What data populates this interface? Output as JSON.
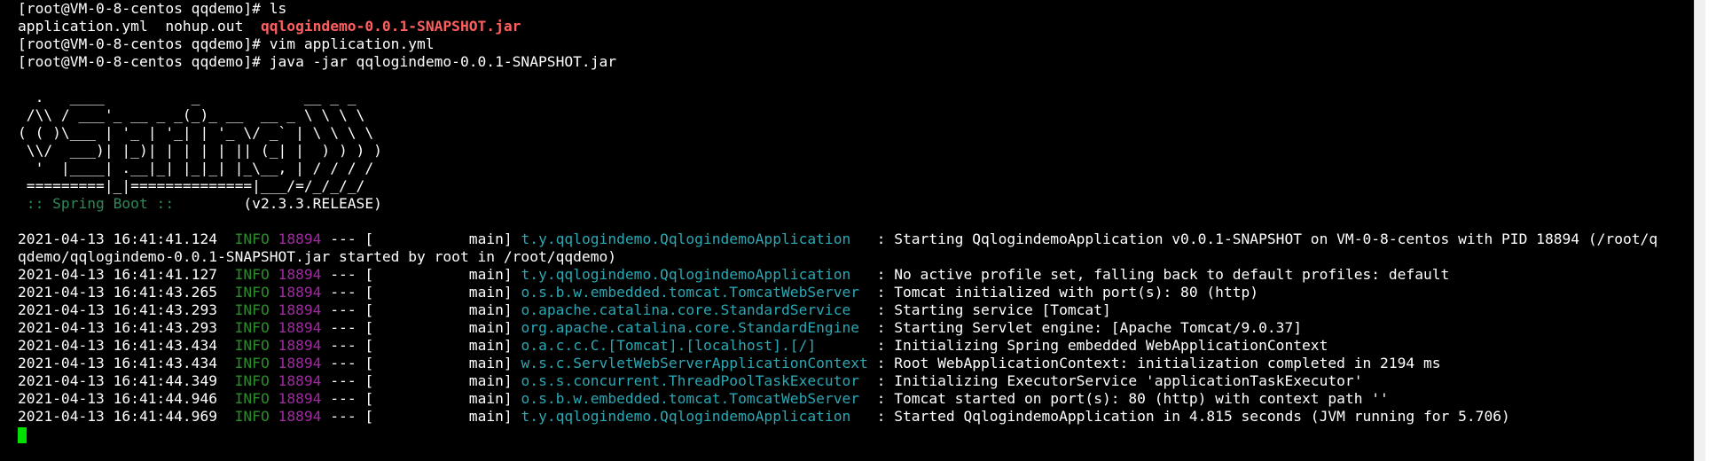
{
  "colors": {
    "background": "#000000",
    "text": "#ffffff",
    "jar_file": "#ff5f5f",
    "spring_label": "#2e8b57",
    "info_level": "#2a8c2a",
    "pid": "#a02aa0",
    "logger": "#2aa8b4",
    "cursor": "#00e000"
  },
  "shell": {
    "line1": "[root@VM-0-8-centos qqdemo]# ls",
    "ls_files_plain": "application.yml  nohup.out  ",
    "ls_jar": "qqlogindemo-0.0.1-SNAPSHOT.jar",
    "line3": "[root@VM-0-8-centos qqdemo]# vim application.yml",
    "line4": "[root@VM-0-8-centos qqdemo]# java -jar qqlogindemo-0.0.1-SNAPSHOT.jar"
  },
  "banner": {
    "art": [
      "  .   ____          _            __ _ _",
      " /\\\\ / ___'_ __ _ _(_)_ __  __ _ \\ \\ \\ \\",
      "( ( )\\___ | '_ | '_| | '_ \\/ _` | \\ \\ \\ \\",
      " \\\\/  ___)| |_)| | | | | || (_| |  ) ) ) )",
      "  '  |____| .__|_| |_|_| |_\\__, | / / / /",
      " =========|_|==============|___/=/_/_/_/"
    ],
    "spring_label": " :: Spring Boot :: ",
    "version": "       (v2.3.3.RELEASE)"
  },
  "logs": [
    {
      "ts": "2021-04-13 16:41:41.124",
      "level": "INFO",
      "pid": "18894",
      "thread": " --- [           main] ",
      "logger": "t.y.qqlogindemo.QqlogindemoApplication  ",
      "msg": " : Starting QqlogindemoApplication v0.0.1-SNAPSHOT on VM-0-8-centos with PID 18894 (/root/q"
    },
    {
      "continuation": "qdemo/qqlogindemo-0.0.1-SNAPSHOT.jar started by root in /root/qqdemo)"
    },
    {
      "ts": "2021-04-13 16:41:41.127",
      "level": "INFO",
      "pid": "18894",
      "thread": " --- [           main] ",
      "logger": "t.y.qqlogindemo.QqlogindemoApplication  ",
      "msg": " : No active profile set, falling back to default profiles: default"
    },
    {
      "ts": "2021-04-13 16:41:43.265",
      "level": "INFO",
      "pid": "18894",
      "thread": " --- [           main] ",
      "logger": "o.s.b.w.embedded.tomcat.TomcatWebServer ",
      "msg": " : Tomcat initialized with port(s): 80 (http)"
    },
    {
      "ts": "2021-04-13 16:41:43.293",
      "level": "INFO",
      "pid": "18894",
      "thread": " --- [           main] ",
      "logger": "o.apache.catalina.core.StandardService  ",
      "msg": " : Starting service [Tomcat]"
    },
    {
      "ts": "2021-04-13 16:41:43.293",
      "level": "INFO",
      "pid": "18894",
      "thread": " --- [           main] ",
      "logger": "org.apache.catalina.core.StandardEngine ",
      "msg": " : Starting Servlet engine: [Apache Tomcat/9.0.37]"
    },
    {
      "ts": "2021-04-13 16:41:43.434",
      "level": "INFO",
      "pid": "18894",
      "thread": " --- [           main] ",
      "logger": "o.a.c.c.C.[Tomcat].[localhost].[/]      ",
      "msg": " : Initializing Spring embedded WebApplicationContext"
    },
    {
      "ts": "2021-04-13 16:41:43.434",
      "level": "INFO",
      "pid": "18894",
      "thread": " --- [           main] ",
      "logger": "w.s.c.ServletWebServerApplicationContext",
      "msg": " : Root WebApplicationContext: initialization completed in 2194 ms"
    },
    {
      "ts": "2021-04-13 16:41:44.349",
      "level": "INFO",
      "pid": "18894",
      "thread": " --- [           main] ",
      "logger": "o.s.s.concurrent.ThreadPoolTaskExecutor ",
      "msg": " : Initializing ExecutorService 'applicationTaskExecutor'"
    },
    {
      "ts": "2021-04-13 16:41:44.946",
      "level": "INFO",
      "pid": "18894",
      "thread": " --- [           main] ",
      "logger": "o.s.b.w.embedded.tomcat.TomcatWebServer ",
      "msg": " : Tomcat started on port(s): 80 (http) with context path ''"
    },
    {
      "ts": "2021-04-13 16:41:44.969",
      "level": "INFO",
      "pid": "18894",
      "thread": " --- [           main] ",
      "logger": "t.y.qqlogindemo.QqlogindemoApplication  ",
      "msg": " : Started QqlogindemoApplication in 4.815 seconds (JVM running for 5.706)"
    }
  ]
}
